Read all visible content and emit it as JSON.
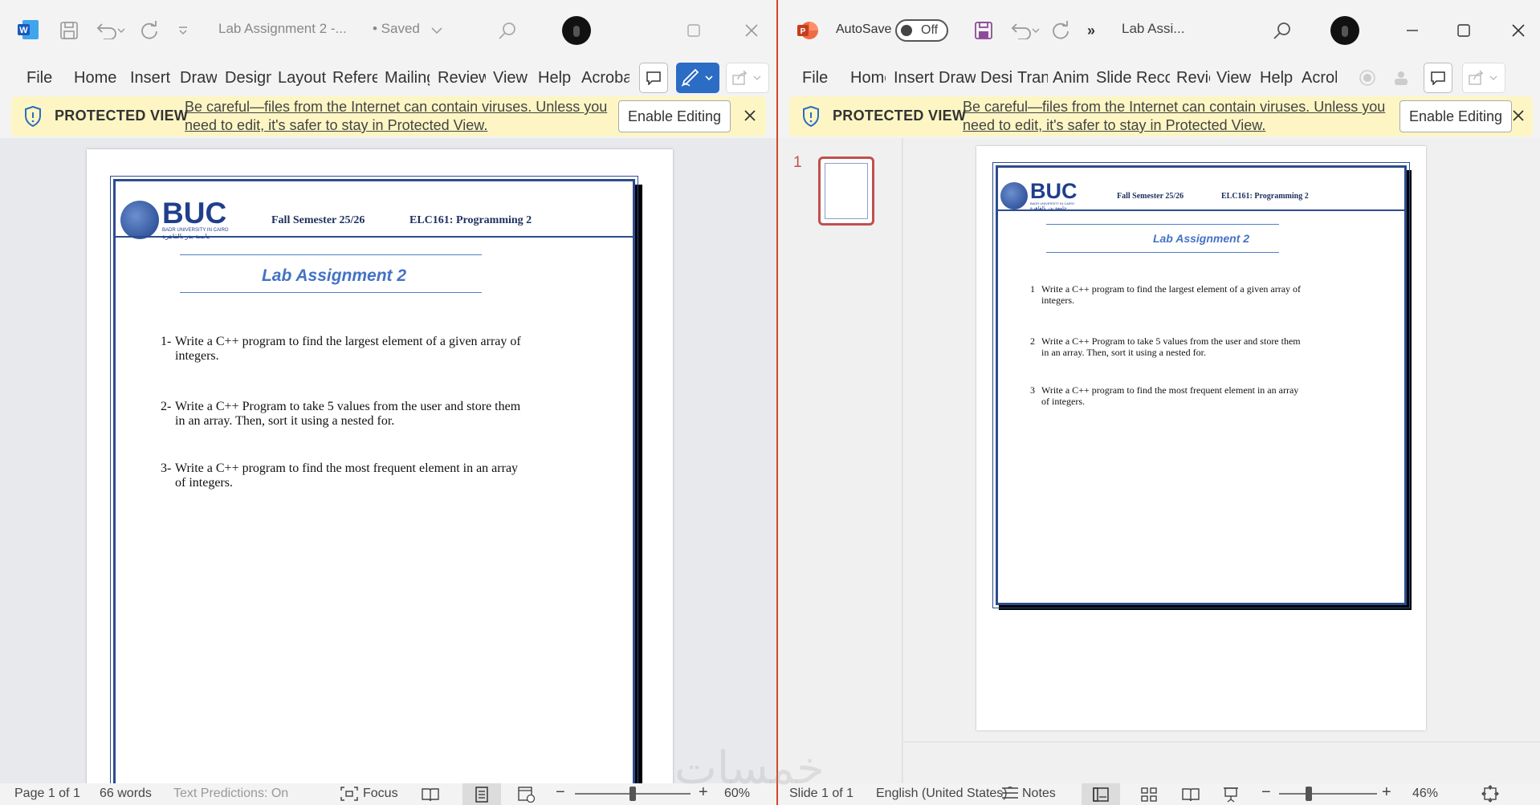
{
  "word": {
    "title": "Lab Assignment 2  -...",
    "saved_status": "• Saved",
    "tabs": [
      "File",
      "Home",
      "Insert",
      "Draw",
      "Design",
      "Layout",
      "References",
      "Mailings",
      "Review",
      "View",
      "Help",
      "Acrobat"
    ],
    "protected_view": {
      "label": "PROTECTED VIEW",
      "message": "Be careful—files from the Internet can contain viruses. Unless you need to edit, it's safer to stay in Protected View.",
      "enable_button": "Enable Editing"
    },
    "status": {
      "page": "Page 1 of 1",
      "words": "66 words",
      "text_predictions": "Text Predictions: On",
      "focus": "Focus",
      "zoom": "60%",
      "zoom_fraction": 0.5
    }
  },
  "ppt": {
    "autosave_label": "AutoSave",
    "autosave_state": "Off",
    "title": "Lab Assi...",
    "tabs": [
      "File",
      "Home",
      "Insert",
      "Draw",
      "Design",
      "Transitions",
      "Animations",
      "Slide Show",
      "Record",
      "Review",
      "View",
      "Help",
      "Acrobat"
    ],
    "protected_view": {
      "label": "PROTECTED VIEW",
      "message": "Be careful—files from the Internet can contain viruses. Unless you need to edit, it's safer to stay in Protected View.",
      "enable_button": "Enable Editing"
    },
    "slide_number": "1",
    "status": {
      "slide": "Slide 1 of 1",
      "language": "English (United States)",
      "notes": "Notes",
      "zoom": "46%",
      "zoom_fraction": 0.3
    }
  },
  "document": {
    "logo": "BUC",
    "logo_sub_en": "BADR UNIVERSITY IN CAIRO",
    "logo_sub_ar": "جامعة بدر بالقاهرة",
    "semester": "Fall Semester 25/26",
    "course": "ELC161: Programming 2",
    "title": "Lab Assignment 2",
    "word_questions": [
      {
        "num": "1-",
        "line1": "Write a C++ program to find the largest element of a given array of",
        "line2": "integers."
      },
      {
        "num": "2-",
        "line1": "Write a C++ Program to take 5 values from the user and store them",
        "line2": "in an array. Then, sort it using a nested for."
      },
      {
        "num": "3-",
        "line1": "Write a C++ program to find the most frequent element in an array",
        "line2": "of integers."
      }
    ],
    "ppt_questions": [
      {
        "num": "1",
        "line1": "Write a C++ program to find the largest element of a given array of",
        "line2": "integers."
      },
      {
        "num": "2",
        "line1": "Write a C++ Program to take 5 values from the user and store them",
        "line2": "in an array. Then, sort it using a nested for."
      },
      {
        "num": "3",
        "line1": "Write a C++ program to find the most frequent element in an array",
        "line2": "of integers."
      }
    ]
  },
  "watermark": "خمسات"
}
